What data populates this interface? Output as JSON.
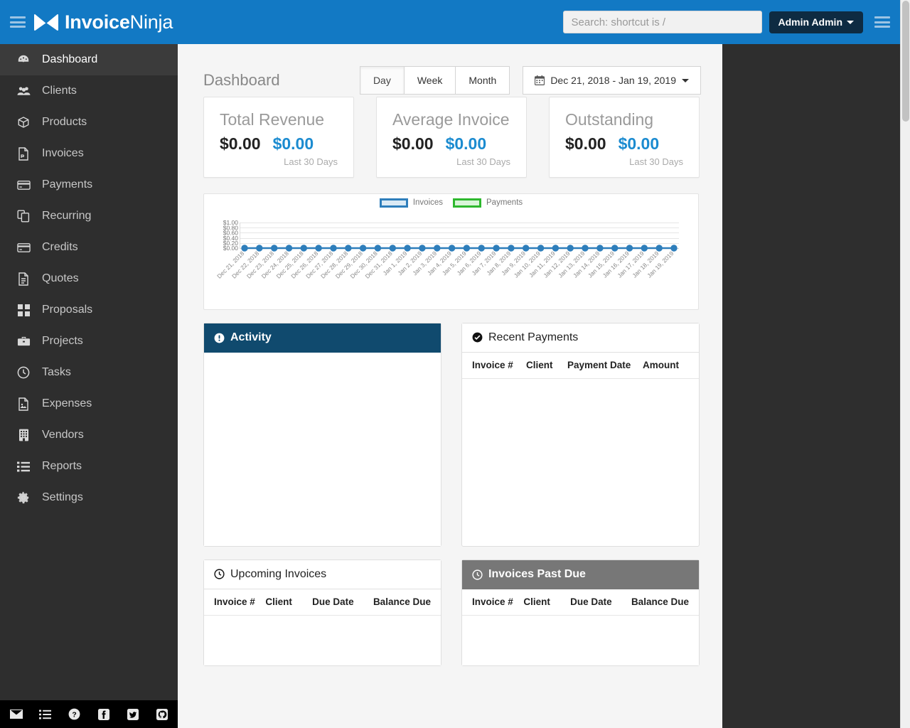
{
  "app": {
    "brand_bold": "Invoice",
    "brand_light": "Ninja",
    "menu_icon": "hamburger-icon",
    "mail_icon": "envelope-logo-icon"
  },
  "topbar": {
    "search_placeholder": "Search: shortcut is /",
    "search_value": "",
    "user_label": "Admin Admin",
    "right_menu_icon": "hamburger-icon",
    "background_color": "#1279c4",
    "user_btn_color": "#0e2b42"
  },
  "sidebar": {
    "background_color": "#2e2e2e",
    "items": [
      {
        "label": "Dashboard",
        "icon": "dashboard-gauge-icon",
        "active": true
      },
      {
        "label": "Clients",
        "icon": "users-group-icon",
        "active": false
      },
      {
        "label": "Products",
        "icon": "box-cube-icon",
        "active": false
      },
      {
        "label": "Invoices",
        "icon": "file-pdf-icon",
        "active": false
      },
      {
        "label": "Payments",
        "icon": "credit-card-icon",
        "active": false
      },
      {
        "label": "Recurring",
        "icon": "copy-files-icon",
        "active": false
      },
      {
        "label": "Credits",
        "icon": "credit-card-icon",
        "active": false
      },
      {
        "label": "Quotes",
        "icon": "file-text-icon",
        "active": false
      },
      {
        "label": "Proposals",
        "icon": "grid-squares-icon",
        "active": false
      },
      {
        "label": "Projects",
        "icon": "briefcase-icon",
        "active": false
      },
      {
        "label": "Tasks",
        "icon": "clock-icon",
        "active": false
      },
      {
        "label": "Expenses",
        "icon": "image-file-icon",
        "active": false
      },
      {
        "label": "Vendors",
        "icon": "building-icon",
        "active": false
      },
      {
        "label": "Reports",
        "icon": "list-icon",
        "active": false
      },
      {
        "label": "Settings",
        "icon": "gear-icon",
        "active": false
      }
    ],
    "footer_icons": [
      "envelope-icon",
      "list-icon",
      "help-question-icon",
      "facebook-icon",
      "twitter-icon",
      "github-icon"
    ]
  },
  "main": {
    "page_title": "Dashboard",
    "range_tabs": [
      {
        "label": "Day",
        "active": true
      },
      {
        "label": "Week",
        "active": false
      },
      {
        "label": "Month",
        "active": false
      }
    ],
    "date_range": {
      "icon": "calendar-icon",
      "label": "Dec 21, 2018 - Jan 19, 2019"
    },
    "stat_cards": [
      {
        "title": "Total Revenue",
        "value_primary": "$0.00",
        "value_secondary": "$0.00",
        "subtitle": "Last 30 Days"
      },
      {
        "title": "Average Invoice",
        "value_primary": "$0.00",
        "value_secondary": "$0.00",
        "subtitle": "Last 30 Days"
      },
      {
        "title": "Outstanding",
        "value_primary": "$0.00",
        "value_secondary": "$0.00",
        "subtitle": "Last 30 Days"
      }
    ],
    "panels": {
      "activity": {
        "title": "Activity",
        "icon": "exclamation-circle-icon",
        "header_color": "#104a6e",
        "rows": []
      },
      "recent_payments": {
        "title": "Recent Payments",
        "icon": "check-circle-icon",
        "header_color": "#ffffff",
        "columns": [
          "Invoice #",
          "Client",
          "Payment Date",
          "Amount"
        ],
        "rows": []
      },
      "upcoming_invoices": {
        "title": "Upcoming Invoices",
        "icon": "clock-icon",
        "header_color": "#ffffff",
        "columns": [
          "Invoice #",
          "Client",
          "Due Date",
          "Balance Due"
        ],
        "rows": []
      },
      "invoices_past_due": {
        "title": "Invoices Past Due",
        "icon": "clock-icon",
        "header_color": "#777777",
        "columns": [
          "Invoice #",
          "Client",
          "Due Date",
          "Balance Due"
        ],
        "rows": []
      }
    }
  },
  "chart_data": {
    "type": "line",
    "title": "",
    "xlabel": "",
    "ylabel": "",
    "ylim": [
      0,
      1
    ],
    "yticks": [
      "$0.00",
      "$0.20",
      "$0.40",
      "$0.60",
      "$0.80",
      "$1.00"
    ],
    "grid": true,
    "legend_position": "top-center",
    "legend": [
      "Invoices",
      "Payments"
    ],
    "colors": {
      "invoices": "#2e7ebb",
      "payments": "#2eb82e"
    },
    "categories": [
      "Dec 21, 2018",
      "Dec 22, 2018",
      "Dec 23, 2018",
      "Dec 24, 2018",
      "Dec 25, 2018",
      "Dec 26, 2018",
      "Dec 27, 2018",
      "Dec 28, 2018",
      "Dec 29, 2018",
      "Dec 30, 2018",
      "Dec 31, 2018",
      "Jan 1, 2019",
      "Jan 2, 2019",
      "Jan 3, 2019",
      "Jan 4, 2019",
      "Jan 5, 2019",
      "Jan 6, 2019",
      "Jan 7, 2019",
      "Jan 8, 2019",
      "Jan 9, 2019",
      "Jan 10, 2019",
      "Jan 11, 2019",
      "Jan 12, 2019",
      "Jan 13, 2019",
      "Jan 14, 2019",
      "Jan 15, 2019",
      "Jan 16, 2019",
      "Jan 17, 2019",
      "Jan 18, 2019",
      "Jan 19, 2019"
    ],
    "series": [
      {
        "name": "Invoices",
        "values": [
          0,
          0,
          0,
          0,
          0,
          0,
          0,
          0,
          0,
          0,
          0,
          0,
          0,
          0,
          0,
          0,
          0,
          0,
          0,
          0,
          0,
          0,
          0,
          0,
          0,
          0,
          0,
          0,
          0,
          0
        ]
      },
      {
        "name": "Payments",
        "values": [
          0,
          0,
          0,
          0,
          0,
          0,
          0,
          0,
          0,
          0,
          0,
          0,
          0,
          0,
          0,
          0,
          0,
          0,
          0,
          0,
          0,
          0,
          0,
          0,
          0,
          0,
          0,
          0,
          0,
          0
        ]
      }
    ]
  }
}
